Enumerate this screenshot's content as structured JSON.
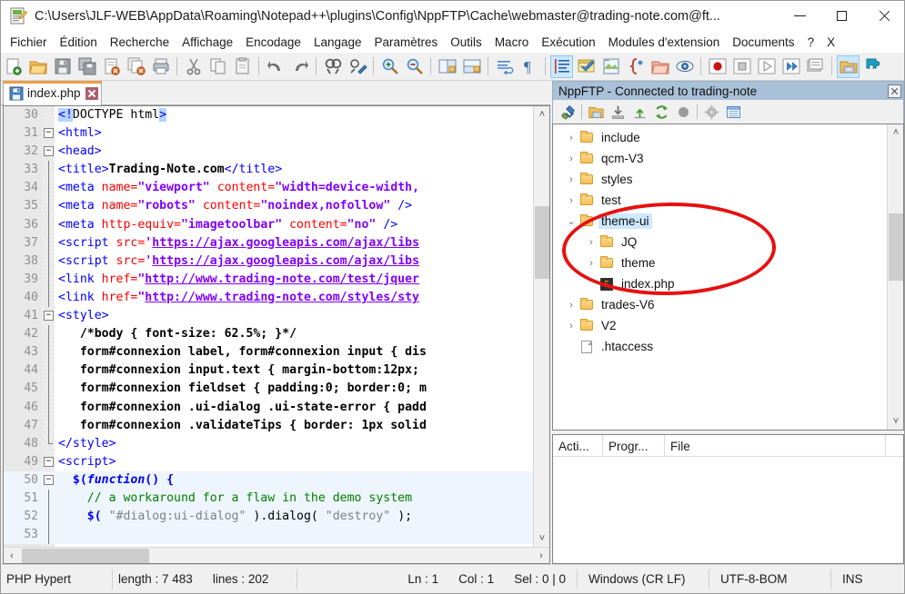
{
  "window": {
    "title": "C:\\Users\\JLF-WEB\\AppData\\Roaming\\Notepad++\\plugins\\Config\\NppFTP\\Cache\\webmaster@trading-note.com@ft...",
    "icon": "notepad-plus-plus-icon",
    "minimize_label": "—",
    "maximize_label": "□",
    "close_label": "✕"
  },
  "menu": {
    "items": [
      "Fichier",
      "Édition",
      "Recherche",
      "Affichage",
      "Encodage",
      "Langage",
      "Paramètres",
      "Outils",
      "Macro",
      "Exécution",
      "Modules d'extension",
      "Documents",
      "?",
      "X"
    ]
  },
  "toolbar": {
    "buttons": [
      "new-file-icon",
      "open-file-icon",
      "save-icon",
      "save-all-icon",
      "close-file-icon",
      "close-all-icon",
      "print-icon",
      "sep",
      "cut-icon",
      "copy-icon",
      "paste-icon",
      "sep",
      "undo-icon",
      "redo-icon",
      "sep",
      "find-icon",
      "replace-icon",
      "sep",
      "zoom-in-icon",
      "zoom-out-icon",
      "sep",
      "sync-vertical-icon",
      "sync-horizontal-icon",
      "sep",
      "word-wrap-icon",
      "show-all-chars-icon",
      "sep",
      "indent-guide-icon",
      "user-defined-dialog-icon",
      "show-doc-map-icon",
      "function-list-icon",
      "folder-as-workspace-icon",
      "monitoring-icon",
      "sep",
      "macro-record-icon",
      "macro-stop-icon",
      "macro-playback-icon",
      "macro-run-multiple-icon",
      "macro-save-icon",
      "sep",
      "ftp-panel-icon",
      "plugin-manager-icon"
    ]
  },
  "tabs": [
    {
      "label": "index.php",
      "icon": "save-blue-icon",
      "close": "close-tab-icon",
      "active": true
    }
  ],
  "editor": {
    "first_line": 30,
    "lines": [
      {
        "n": 30,
        "fold": "none",
        "indent": 0,
        "tokens": [
          {
            "t": "<!",
            "c": "t-sel"
          },
          {
            "t": "DOCTYPE html",
            "c": "t-plain"
          },
          {
            "t": ">",
            "c": "t-sel"
          }
        ]
      },
      {
        "n": 31,
        "fold": "open",
        "tokens": [
          {
            "t": "<html>",
            "c": "t-tag"
          }
        ]
      },
      {
        "n": 32,
        "fold": "open",
        "tokens": [
          {
            "t": "<head>",
            "c": "t-tag"
          }
        ]
      },
      {
        "n": 33,
        "fold": "bar",
        "tokens": [
          {
            "t": "<title>",
            "c": "t-tag"
          },
          {
            "t": "Trading-Note.com",
            "c": "t-txt"
          },
          {
            "t": "</title>",
            "c": "t-tag"
          }
        ]
      },
      {
        "n": 34,
        "fold": "bar",
        "tokens": [
          {
            "t": "<meta ",
            "c": "t-tag"
          },
          {
            "t": "name=",
            "c": "t-attr"
          },
          {
            "t": "\"viewport\"",
            "c": "t-val"
          },
          {
            "t": " content=",
            "c": "t-attr"
          },
          {
            "t": "\"width=device-width,",
            "c": "t-val"
          }
        ]
      },
      {
        "n": 35,
        "fold": "bar",
        "tokens": [
          {
            "t": "<meta ",
            "c": "t-tag"
          },
          {
            "t": "name=",
            "c": "t-attr"
          },
          {
            "t": "\"robots\"",
            "c": "t-val"
          },
          {
            "t": " content=",
            "c": "t-attr"
          },
          {
            "t": "\"noindex,nofollow\"",
            "c": "t-val"
          },
          {
            "t": " />",
            "c": "t-tag"
          }
        ]
      },
      {
        "n": 36,
        "fold": "bar",
        "tokens": [
          {
            "t": "<meta ",
            "c": "t-tag"
          },
          {
            "t": "http-equiv=",
            "c": "t-attr"
          },
          {
            "t": "\"imagetoolbar\"",
            "c": "t-val"
          },
          {
            "t": " content=",
            "c": "t-attr"
          },
          {
            "t": "\"no\"",
            "c": "t-val"
          },
          {
            "t": " />",
            "c": "t-tag"
          }
        ]
      },
      {
        "n": 37,
        "fold": "bar",
        "tokens": [
          {
            "t": "<script ",
            "c": "t-tag"
          },
          {
            "t": "src=",
            "c": "t-attr"
          },
          {
            "t": "'",
            "c": "t-val"
          },
          {
            "t": "https://ajax.googleapis.com/ajax/libs",
            "c": "t-url"
          }
        ]
      },
      {
        "n": 38,
        "fold": "bar",
        "tokens": [
          {
            "t": "<script ",
            "c": "t-tag"
          },
          {
            "t": "src=",
            "c": "t-attr"
          },
          {
            "t": "'",
            "c": "t-val"
          },
          {
            "t": "https://ajax.googleapis.com/ajax/libs",
            "c": "t-url"
          }
        ]
      },
      {
        "n": 39,
        "fold": "bar",
        "tokens": [
          {
            "t": "<link ",
            "c": "t-tag"
          },
          {
            "t": "href=",
            "c": "t-attr"
          },
          {
            "t": "\"",
            "c": "t-val"
          },
          {
            "t": "http://www.trading-note.com/test/jquer",
            "c": "t-url"
          }
        ]
      },
      {
        "n": 40,
        "fold": "bar",
        "tokens": [
          {
            "t": "<link ",
            "c": "t-tag"
          },
          {
            "t": "href=",
            "c": "t-attr"
          },
          {
            "t": "\"",
            "c": "t-val"
          },
          {
            "t": "http://www.trading-note.com/styles/sty",
            "c": "t-url"
          }
        ]
      },
      {
        "n": 41,
        "fold": "open",
        "tokens": [
          {
            "t": "<style>",
            "c": "t-tag"
          }
        ]
      },
      {
        "n": 42,
        "fold": "bar",
        "tokens": [
          {
            "t": "   /*body { font-size: 62.5%; }*/",
            "c": "t-css"
          }
        ]
      },
      {
        "n": 43,
        "fold": "bar",
        "tokens": [
          {
            "t": "   form#connexion label, form#connexion input { dis",
            "c": "t-css"
          }
        ]
      },
      {
        "n": 44,
        "fold": "bar",
        "tokens": [
          {
            "t": "   form#connexion input.text { margin-bottom:12px; ",
            "c": "t-css"
          }
        ]
      },
      {
        "n": 45,
        "fold": "bar",
        "tokens": [
          {
            "t": "   form#connexion fieldset { padding:0; border:0; m",
            "c": "t-css"
          }
        ]
      },
      {
        "n": 46,
        "fold": "bar",
        "tokens": [
          {
            "t": "   form#connexion .ui-dialog .ui-state-error { padd",
            "c": "t-css"
          }
        ]
      },
      {
        "n": 47,
        "fold": "bar",
        "tokens": [
          {
            "t": "   form#connexion .validateTips { border: 1px solid",
            "c": "t-css"
          }
        ]
      },
      {
        "n": 48,
        "fold": "end",
        "tokens": [
          {
            "t": "</style>",
            "c": "t-tag"
          }
        ]
      },
      {
        "n": 49,
        "fold": "open",
        "tokens": [
          {
            "t": "<script>",
            "c": "t-tag"
          }
        ]
      },
      {
        "n": 50,
        "fold": "open",
        "hl": true,
        "tokens": [
          {
            "t": "  $(",
            "c": "t-op"
          },
          {
            "t": "function",
            "c": "t-kw"
          },
          {
            "t": "() {",
            "c": "t-op"
          }
        ]
      },
      {
        "n": 51,
        "fold": "bar",
        "hl": true,
        "tokens": [
          {
            "t": "    // a workaround for a flaw in the demo system",
            "c": "t-cmt"
          }
        ]
      },
      {
        "n": 52,
        "fold": "bar",
        "hl": true,
        "tokens": [
          {
            "t": "    $( ",
            "c": "t-op"
          },
          {
            "t": "\"#dialog:ui-dialog\"",
            "c": "t-str"
          },
          {
            "t": " ).dialog( ",
            "c": "t-plain"
          },
          {
            "t": "\"destroy\"",
            "c": "t-str"
          },
          {
            "t": " );",
            "c": "t-plain"
          }
        ]
      },
      {
        "n": 53,
        "fold": "bar",
        "hl": true,
        "tokens": []
      }
    ],
    "vscroll_arrow_up": "˄",
    "vscroll_arrow_down": "˅",
    "hscroll_arrow_left": "‹",
    "hscroll_arrow_right": "›"
  },
  "ftp": {
    "title": "NppFTP - Connected to trading-note",
    "close_label": "✕",
    "toolbar_buttons": [
      "connect-icon",
      "sep",
      "open-folder-icon",
      "download-icon",
      "upload-icon",
      "refresh-icon",
      "abort-icon",
      "sep",
      "settings-icon",
      "messages-icon"
    ],
    "tree": [
      {
        "label": "include",
        "icon": "folder-icon",
        "twist": "›",
        "depth": 0,
        "selected": false
      },
      {
        "label": "qcm-V3",
        "icon": "folder-icon",
        "twist": "›",
        "depth": 0,
        "selected": false
      },
      {
        "label": "styles",
        "icon": "folder-icon",
        "twist": "›",
        "depth": 0,
        "selected": false
      },
      {
        "label": "test",
        "icon": "folder-icon",
        "twist": "›",
        "depth": 0,
        "selected": false
      },
      {
        "label": "theme-ui",
        "icon": "folder-icon",
        "twist": "⌄",
        "depth": 0,
        "selected": true
      },
      {
        "label": "JQ",
        "icon": "folder-icon",
        "twist": "›",
        "depth": 1,
        "selected": false
      },
      {
        "label": "theme",
        "icon": "folder-icon",
        "twist": "›",
        "depth": 1,
        "selected": false
      },
      {
        "label": "index.php",
        "icon": "php-file-icon",
        "twist": "",
        "depth": 1,
        "selected": false
      },
      {
        "label": "trades-V6",
        "icon": "folder-icon",
        "twist": "›",
        "depth": 0,
        "selected": false
      },
      {
        "label": "V2",
        "icon": "folder-icon",
        "twist": "›",
        "depth": 0,
        "selected": false
      },
      {
        "label": ".htaccess",
        "icon": "generic-file-icon",
        "twist": "",
        "depth": 0,
        "selected": false
      }
    ],
    "queue_columns": [
      "Acti...",
      "Progr...",
      "File"
    ],
    "queue_rows": []
  },
  "annotation": {
    "shape": "ellipse",
    "color": "#e81010",
    "target": "theme-ui folder expanded with JQ, theme and index.php"
  },
  "statusbar": {
    "language": "PHP Hypert",
    "length_label": "length : 7 483",
    "lines_label": "lines : 202",
    "ln": "Ln : 1",
    "col": "Col : 1",
    "sel": "Sel : 0 | 0",
    "eol": "Windows (CR LF)",
    "encoding": "UTF-8-BOM",
    "insert_mode": "INS"
  },
  "colors": {
    "ftp_title_bg": "#a8c0d8",
    "tab_accent": "#eb9f45",
    "selection": "#cde8ff",
    "annotation_red": "#e81010",
    "gutter_bg": "#e8e8e8",
    "highlight_line": "#eef5fd"
  }
}
